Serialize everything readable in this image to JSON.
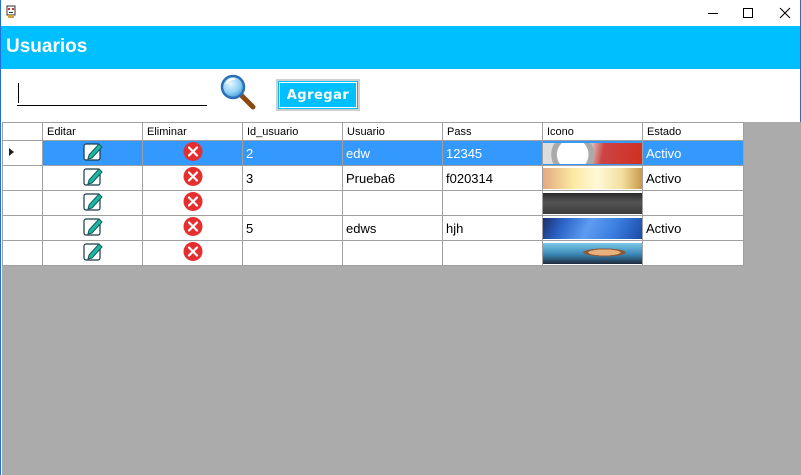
{
  "window": {
    "icon": "app-logo-icon",
    "controls": [
      "minimize-icon",
      "maximize-icon",
      "close-icon"
    ]
  },
  "header": {
    "title": "Usuarios"
  },
  "search": {
    "value": "",
    "placeholder": ""
  },
  "toolbar": {
    "add_label": "Agregar"
  },
  "colors": {
    "accent": "#00bfff",
    "selection": "#3399ff",
    "empty_area": "#ababab",
    "delete_red": "#e52e2e",
    "edit_teal": "#1fb5a6"
  },
  "grid": {
    "columns": [
      "Editar",
      "Eliminar",
      "Id_usuario",
      "Usuario",
      "Pass",
      "Icono",
      "Estado"
    ],
    "rows": [
      {
        "id": "2",
        "usuario": "edw",
        "pass": "12345",
        "estado": "Activo",
        "selected": true
      },
      {
        "id": "3",
        "usuario": "Prueba6",
        "pass": "f020314",
        "estado": "Activo",
        "selected": false
      },
      {
        "id": "",
        "usuario": "",
        "pass": "",
        "estado": "",
        "selected": false
      },
      {
        "id": "5",
        "usuario": "edws",
        "pass": "hjh",
        "estado": "Activo",
        "selected": false
      },
      {
        "id": "",
        "usuario": "",
        "pass": "",
        "estado": "",
        "selected": false
      }
    ]
  }
}
